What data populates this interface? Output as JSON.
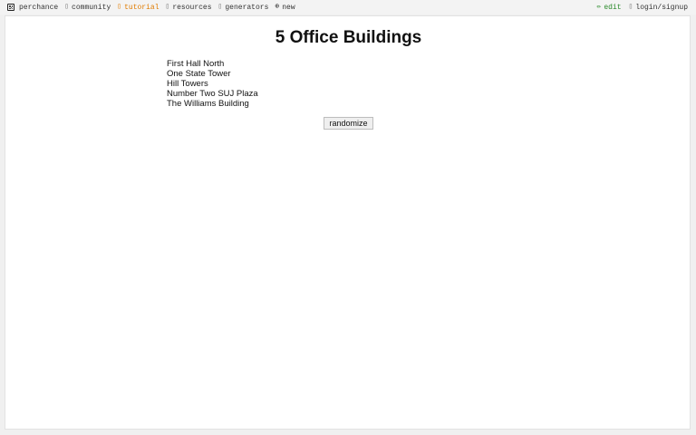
{
  "nav": {
    "brand": "perchance",
    "items": [
      {
        "label": "community",
        "icon": "chat-icon",
        "glyph": "▯"
      },
      {
        "label": "tutorial",
        "icon": "book-icon",
        "glyph": "▯"
      },
      {
        "label": "resources",
        "icon": "box-icon",
        "glyph": "▯"
      },
      {
        "label": "generators",
        "icon": "list-icon",
        "glyph": "▯"
      },
      {
        "label": "new",
        "icon": "plus-circle-icon",
        "glyph": "⊕"
      }
    ],
    "edit_label": "edit",
    "edit_glyph": "✏",
    "login_label": "login/signup",
    "login_glyph": "▯",
    "active_color": "#e07b00",
    "edit_color": "#2b8a2b"
  },
  "main": {
    "title": "5 Office Buildings",
    "items": [
      "First Hall North",
      "One State Tower",
      "Hill Towers",
      "Number Two SUJ Plaza",
      "The Williams Building"
    ],
    "randomize_label": "randomize"
  }
}
